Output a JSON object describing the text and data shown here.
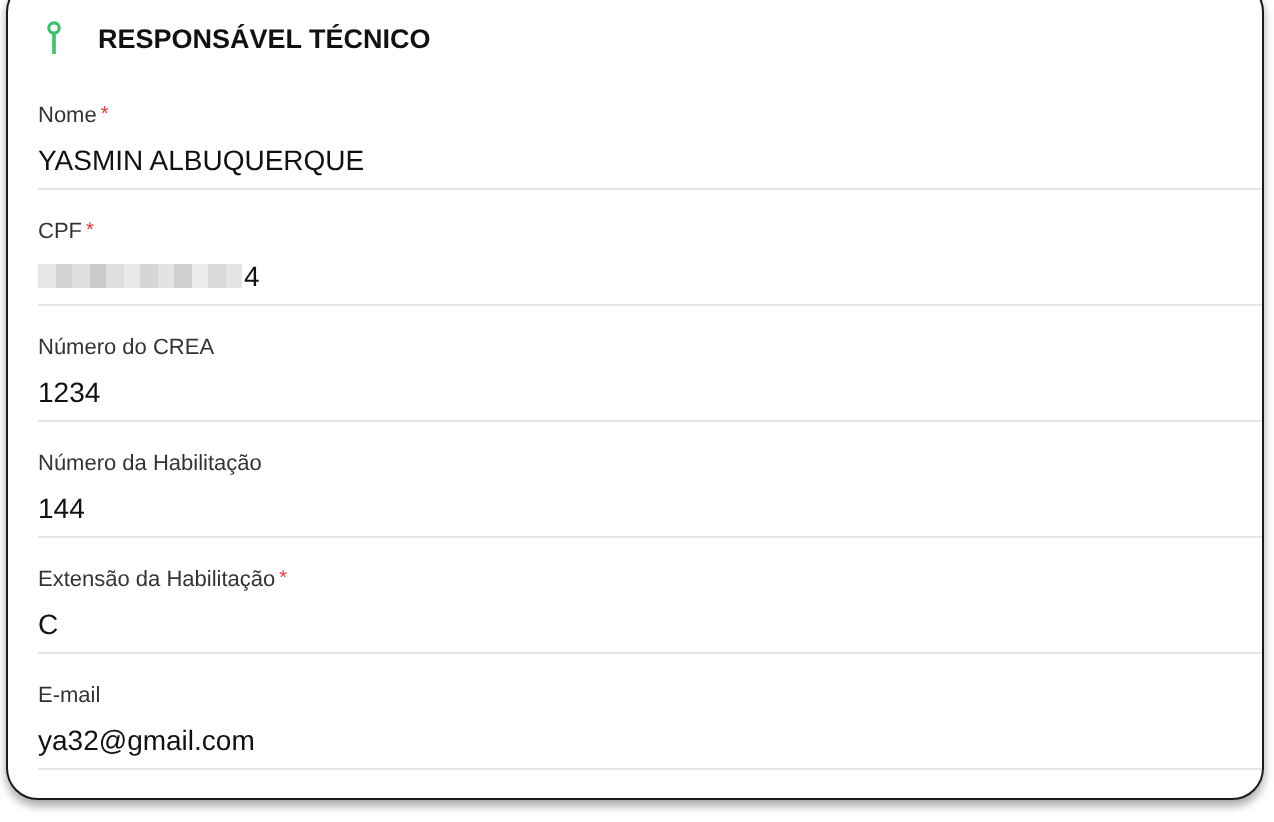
{
  "section": {
    "title": "RESPONSÁVEL TÉCNICO"
  },
  "fields": [
    {
      "label": "Nome",
      "required_mark": "*",
      "value": "YASMIN ALBUQUERQUE",
      "redacted": false
    },
    {
      "label": "CPF",
      "required_mark": "*",
      "value": "4",
      "redacted": true
    },
    {
      "label": "Número do CREA",
      "value": "1234",
      "redacted": false
    },
    {
      "label": "Número da Habilitação",
      "value": "144",
      "redacted": false
    },
    {
      "label": "Extensão da Habilitação",
      "required_mark": "*",
      "value": "C",
      "redacted": false
    },
    {
      "label": "E-mail",
      "value": "ya32@gmail.com",
      "redacted": false
    }
  ]
}
